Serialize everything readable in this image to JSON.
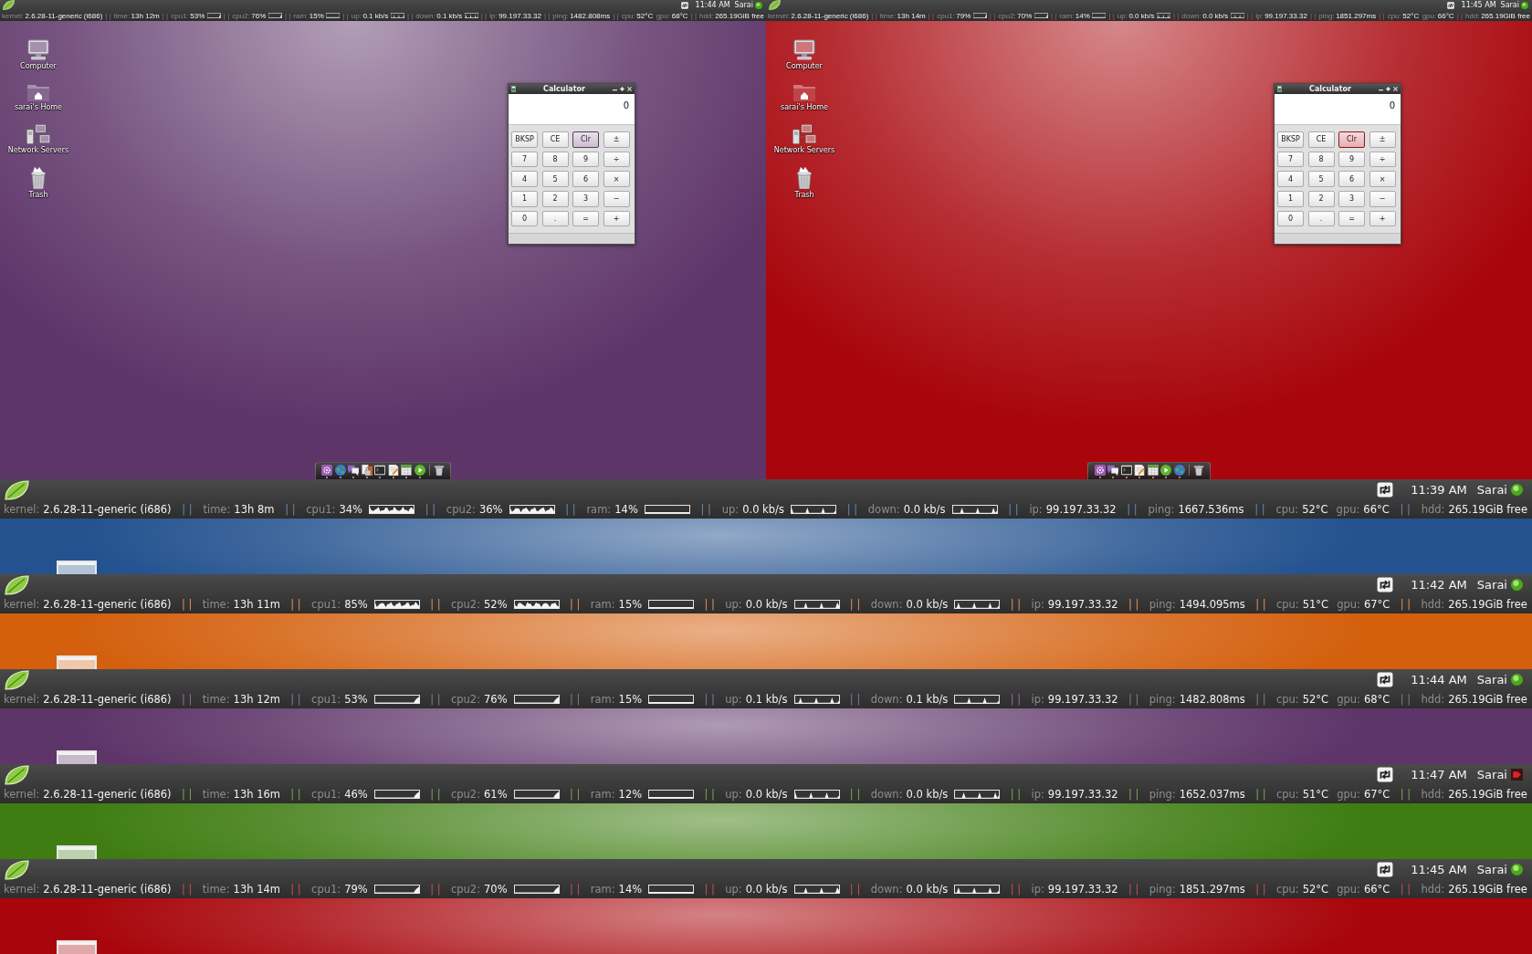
{
  "desktops": [
    {
      "color": "#5e3569",
      "panel": {
        "time": "11:44 AM",
        "user": "Sarai",
        "alert": false,
        "stats": [
          {
            "kind": "text",
            "label": "kernel:",
            "value": "2.6.28-11-generic (i686)"
          },
          {
            "kind": "sep",
            "text": "| |"
          },
          {
            "kind": "text",
            "label": "time:",
            "value": "13h 12m"
          },
          {
            "kind": "sep",
            "text": "| |"
          },
          {
            "kind": "graph",
            "label": "cpu1:",
            "value": "53%"
          },
          {
            "kind": "sep",
            "text": "| |"
          },
          {
            "kind": "graph",
            "label": "cpu2:",
            "value": "76%"
          },
          {
            "kind": "sep",
            "text": "| |"
          },
          {
            "kind": "graph",
            "label": "ram:",
            "value": "15%"
          },
          {
            "kind": "sep",
            "text": "| |"
          },
          {
            "kind": "graph",
            "label": "up:",
            "value": "0.1 kb/s"
          },
          {
            "kind": "sep",
            "text": "| |"
          },
          {
            "kind": "graph",
            "label": "down:",
            "value": "0.1 kb/s"
          },
          {
            "kind": "sep",
            "text": "| |"
          },
          {
            "kind": "text",
            "label": "ip:",
            "value": "99.197.33.32"
          },
          {
            "kind": "sep",
            "text": "| |"
          },
          {
            "kind": "text",
            "label": "ping:",
            "value": "1482.808ms"
          },
          {
            "kind": "sep",
            "text": "| |"
          },
          {
            "kind": "text",
            "label": "cpu:",
            "value": "52°C"
          },
          {
            "kind": "text",
            "label": "gpu:",
            "value": "68°C"
          },
          {
            "kind": "sep",
            "text": "| |"
          },
          {
            "kind": "text",
            "label": "hdd:",
            "value": "265.19GiB free"
          }
        ]
      },
      "icons": [
        {
          "kind": "computer",
          "label": "Computer"
        },
        {
          "kind": "home",
          "label": "sarai's Home"
        },
        {
          "kind": "network",
          "label": "Network Servers"
        },
        {
          "kind": "trash",
          "label": "Trash"
        }
      ],
      "calculator": {
        "title": "Calculator",
        "display": "0",
        "keys": [
          [
            {
              "label": "BKSP",
              "focused": false
            },
            {
              "label": "CE",
              "focused": false
            },
            {
              "label": "Clr",
              "focused": true
            },
            {
              "label": "±",
              "focused": false
            }
          ],
          [
            {
              "label": "7",
              "focused": false
            },
            {
              "label": "8",
              "focused": false
            },
            {
              "label": "9",
              "focused": false
            },
            {
              "label": "÷",
              "focused": false
            }
          ],
          [
            {
              "label": "4",
              "focused": false
            },
            {
              "label": "5",
              "focused": false
            },
            {
              "label": "6",
              "focused": false
            },
            {
              "label": "×",
              "focused": false
            }
          ],
          [
            {
              "label": "1",
              "focused": false
            },
            {
              "label": "2",
              "focused": false
            },
            {
              "label": "3",
              "focused": false
            },
            {
              "label": "−",
              "focused": false
            }
          ],
          [
            {
              "label": "0",
              "focused": false
            },
            {
              "label": ".",
              "focused": false
            },
            {
              "label": "=",
              "focused": false
            },
            {
              "label": "+",
              "focused": false
            }
          ]
        ]
      },
      "dock": [
        {
          "kind": "settings",
          "running": true
        },
        {
          "kind": "globe",
          "running": true
        },
        {
          "kind": "chat",
          "running": true
        },
        {
          "kind": "padlock",
          "running": true
        },
        {
          "kind": "terminal",
          "running": true
        },
        {
          "kind": "editor",
          "running": true
        },
        {
          "kind": "spreadsheet",
          "running": true
        },
        {
          "kind": "play",
          "running": true
        },
        {
          "kind": "trash",
          "running": false
        }
      ]
    },
    {
      "color": "#a8060c",
      "panel": {
        "time": "11:45 AM",
        "user": "Sarai",
        "alert": false,
        "stats": [
          {
            "kind": "text",
            "label": "kernel:",
            "value": "2.6.28-11-generic (i686)"
          },
          {
            "kind": "sep",
            "text": "| |"
          },
          {
            "kind": "text",
            "label": "time:",
            "value": "13h 14m"
          },
          {
            "kind": "sep",
            "text": "| |"
          },
          {
            "kind": "graph",
            "label": "cpu1:",
            "value": "79%"
          },
          {
            "kind": "sep",
            "text": "| |"
          },
          {
            "kind": "graph",
            "label": "cpu2:",
            "value": "70%"
          },
          {
            "kind": "sep",
            "text": "| |"
          },
          {
            "kind": "graph",
            "label": "ram:",
            "value": "14%"
          },
          {
            "kind": "sep",
            "text": "| |"
          },
          {
            "kind": "graph",
            "label": "up:",
            "value": "0.0 kb/s"
          },
          {
            "kind": "sep",
            "text": "| |"
          },
          {
            "kind": "graph",
            "label": "down:",
            "value": "0.0 kb/s"
          },
          {
            "kind": "sep",
            "text": "| |"
          },
          {
            "kind": "text",
            "label": "ip:",
            "value": "99.197.33.32"
          },
          {
            "kind": "sep",
            "text": "| |"
          },
          {
            "kind": "text",
            "label": "ping:",
            "value": "1851.297ms"
          },
          {
            "kind": "sep",
            "text": "| |"
          },
          {
            "kind": "text",
            "label": "cpu:",
            "value": "52°C"
          },
          {
            "kind": "text",
            "label": "gpu:",
            "value": "66°C"
          },
          {
            "kind": "sep",
            "text": "| |"
          },
          {
            "kind": "text",
            "label": "hdd:",
            "value": "265.19GiB free"
          }
        ]
      },
      "icons": [
        {
          "kind": "computer",
          "label": "Computer"
        },
        {
          "kind": "home",
          "label": "sarai's Home"
        },
        {
          "kind": "network",
          "label": "Network Servers"
        },
        {
          "kind": "trash",
          "label": "Trash"
        }
      ],
      "calculator": {
        "title": "Calculator",
        "display": "0",
        "keys": [
          [
            {
              "label": "BKSP",
              "focused": false
            },
            {
              "label": "CE",
              "focused": false
            },
            {
              "label": "Clr",
              "focused": true
            },
            {
              "label": "±",
              "focused": false
            }
          ],
          [
            {
              "label": "7",
              "focused": false
            },
            {
              "label": "8",
              "focused": false
            },
            {
              "label": "9",
              "focused": false
            },
            {
              "label": "÷",
              "focused": false
            }
          ],
          [
            {
              "label": "4",
              "focused": false
            },
            {
              "label": "5",
              "focused": false
            },
            {
              "label": "6",
              "focused": false
            },
            {
              "label": "×",
              "focused": false
            }
          ],
          [
            {
              "label": "1",
              "focused": false
            },
            {
              "label": "2",
              "focused": false
            },
            {
              "label": "3",
              "focused": false
            },
            {
              "label": "−",
              "focused": false
            }
          ],
          [
            {
              "label": "0",
              "focused": false
            },
            {
              "label": ".",
              "focused": false
            },
            {
              "label": "=",
              "focused": false
            },
            {
              "label": "+",
              "focused": false
            }
          ]
        ]
      },
      "dock": [
        {
          "kind": "settings",
          "running": true
        },
        {
          "kind": "chat",
          "running": true
        },
        {
          "kind": "terminal",
          "running": true
        },
        {
          "kind": "editor",
          "running": true
        },
        {
          "kind": "spreadsheet",
          "running": true
        },
        {
          "kind": "play",
          "running": true
        },
        {
          "kind": "globe",
          "running": true
        },
        {
          "kind": "trash",
          "running": false
        }
      ]
    }
  ],
  "strips": [
    {
      "color": "#24528f",
      "panel": {
        "time": "11:39 AM",
        "user": "Sarai",
        "alert": false,
        "stats": [
          {
            "kind": "text",
            "label": "kernel:",
            "value": "2.6.28-11-generic (i686)"
          },
          {
            "kind": "sep",
            "text": "| |"
          },
          {
            "kind": "text",
            "label": "time:",
            "value": "13h 8m"
          },
          {
            "kind": "sep",
            "text": "| |"
          },
          {
            "kind": "graph",
            "label": "cpu1:",
            "value": "34%"
          },
          {
            "kind": "sep",
            "text": "| |"
          },
          {
            "kind": "graph",
            "label": "cpu2:",
            "value": "36%"
          },
          {
            "kind": "sep",
            "text": "| |"
          },
          {
            "kind": "graph",
            "label": "ram:",
            "value": "14%"
          },
          {
            "kind": "sep",
            "text": "| |"
          },
          {
            "kind": "graph",
            "label": "up:",
            "value": "0.0 kb/s"
          },
          {
            "kind": "sep",
            "text": "| |"
          },
          {
            "kind": "graph",
            "label": "down:",
            "value": "0.0 kb/s"
          },
          {
            "kind": "sep",
            "text": "| |"
          },
          {
            "kind": "text",
            "label": "ip:",
            "value": "99.197.33.32"
          },
          {
            "kind": "sep",
            "text": "| |"
          },
          {
            "kind": "text",
            "label": "ping:",
            "value": "1667.536ms"
          },
          {
            "kind": "sep",
            "text": "| |"
          },
          {
            "kind": "text",
            "label": "cpu:",
            "value": "52°C"
          },
          {
            "kind": "text",
            "label": "gpu:",
            "value": "66°C"
          },
          {
            "kind": "sep",
            "text": "| |"
          },
          {
            "kind": "text",
            "label": "hdd:",
            "value": "265.19GiB free"
          }
        ]
      }
    },
    {
      "color": "#d4600e",
      "panel": {
        "time": "11:42 AM",
        "user": "Sarai",
        "alert": false,
        "stats": [
          {
            "kind": "text",
            "label": "kernel:",
            "value": "2.6.28-11-generic (i686)"
          },
          {
            "kind": "sep",
            "text": "| |"
          },
          {
            "kind": "text",
            "label": "time:",
            "value": "13h 11m"
          },
          {
            "kind": "sep",
            "text": "| |"
          },
          {
            "kind": "graph",
            "label": "cpu1:",
            "value": "85%"
          },
          {
            "kind": "sep",
            "text": "| |"
          },
          {
            "kind": "graph",
            "label": "cpu2:",
            "value": "52%"
          },
          {
            "kind": "sep",
            "text": "| |"
          },
          {
            "kind": "graph",
            "label": "ram:",
            "value": "15%"
          },
          {
            "kind": "sep",
            "text": "| |"
          },
          {
            "kind": "graph",
            "label": "up:",
            "value": "0.0 kb/s"
          },
          {
            "kind": "sep",
            "text": "| |"
          },
          {
            "kind": "graph",
            "label": "down:",
            "value": "0.0 kb/s"
          },
          {
            "kind": "sep",
            "text": "| |"
          },
          {
            "kind": "text",
            "label": "ip:",
            "value": "99.197.33.32"
          },
          {
            "kind": "sep",
            "text": "| |"
          },
          {
            "kind": "text",
            "label": "ping:",
            "value": "1494.095ms"
          },
          {
            "kind": "sep",
            "text": "| |"
          },
          {
            "kind": "text",
            "label": "cpu:",
            "value": "51°C"
          },
          {
            "kind": "text",
            "label": "gpu:",
            "value": "67°C"
          },
          {
            "kind": "sep",
            "text": "| |"
          },
          {
            "kind": "text",
            "label": "hdd:",
            "value": "265.19GiB free"
          }
        ]
      }
    },
    {
      "color": "#5e3569",
      "panel": {
        "time": "11:44 AM",
        "user": "Sarai",
        "alert": false,
        "stats": [
          {
            "kind": "text",
            "label": "kernel:",
            "value": "2.6.28-11-generic (i686)"
          },
          {
            "kind": "sep",
            "text": "| |"
          },
          {
            "kind": "text",
            "label": "time:",
            "value": "13h 12m"
          },
          {
            "kind": "sep",
            "text": "| |"
          },
          {
            "kind": "graph",
            "label": "cpu1:",
            "value": "53%"
          },
          {
            "kind": "sep",
            "text": "| |"
          },
          {
            "kind": "graph",
            "label": "cpu2:",
            "value": "76%"
          },
          {
            "kind": "sep",
            "text": "| |"
          },
          {
            "kind": "graph",
            "label": "ram:",
            "value": "15%"
          },
          {
            "kind": "sep",
            "text": "| |"
          },
          {
            "kind": "graph",
            "label": "up:",
            "value": "0.1 kb/s"
          },
          {
            "kind": "sep",
            "text": "| |"
          },
          {
            "kind": "graph",
            "label": "down:",
            "value": "0.1 kb/s"
          },
          {
            "kind": "sep",
            "text": "| |"
          },
          {
            "kind": "text",
            "label": "ip:",
            "value": "99.197.33.32"
          },
          {
            "kind": "sep",
            "text": "| |"
          },
          {
            "kind": "text",
            "label": "ping:",
            "value": "1482.808ms"
          },
          {
            "kind": "sep",
            "text": "| |"
          },
          {
            "kind": "text",
            "label": "cpu:",
            "value": "52°C"
          },
          {
            "kind": "text",
            "label": "gpu:",
            "value": "68°C"
          },
          {
            "kind": "sep",
            "text": "| |"
          },
          {
            "kind": "text",
            "label": "hdd:",
            "value": "265.19GiB free"
          }
        ]
      }
    },
    {
      "color": "#3f7d12",
      "panel": {
        "time": "11:47 AM",
        "user": "Sarai",
        "alert": true,
        "stats": [
          {
            "kind": "text",
            "label": "kernel:",
            "value": "2.6.28-11-generic (i686)"
          },
          {
            "kind": "sep",
            "text": "| |"
          },
          {
            "kind": "text",
            "label": "time:",
            "value": "13h 16m"
          },
          {
            "kind": "sep",
            "text": "| |"
          },
          {
            "kind": "graph",
            "label": "cpu1:",
            "value": "46%"
          },
          {
            "kind": "sep",
            "text": "| |"
          },
          {
            "kind": "graph",
            "label": "cpu2:",
            "value": "61%"
          },
          {
            "kind": "sep",
            "text": "| |"
          },
          {
            "kind": "graph",
            "label": "ram:",
            "value": "12%"
          },
          {
            "kind": "sep",
            "text": "| |"
          },
          {
            "kind": "graph",
            "label": "up:",
            "value": "0.0 kb/s"
          },
          {
            "kind": "sep",
            "text": "| |"
          },
          {
            "kind": "graph",
            "label": "down:",
            "value": "0.0 kb/s"
          },
          {
            "kind": "sep",
            "text": "| |"
          },
          {
            "kind": "text",
            "label": "ip:",
            "value": "99.197.33.32"
          },
          {
            "kind": "sep",
            "text": "| |"
          },
          {
            "kind": "text",
            "label": "ping:",
            "value": "1652.037ms"
          },
          {
            "kind": "sep",
            "text": "| |"
          },
          {
            "kind": "text",
            "label": "cpu:",
            "value": "51°C"
          },
          {
            "kind": "text",
            "label": "gpu:",
            "value": "67°C"
          },
          {
            "kind": "sep",
            "text": "| |"
          },
          {
            "kind": "text",
            "label": "hdd:",
            "value": "265.19GiB free"
          }
        ]
      }
    },
    {
      "color": "#a8060c",
      "panel": {
        "time": "11:45 AM",
        "user": "Sarai",
        "alert": false,
        "stats": [
          {
            "kind": "text",
            "label": "kernel:",
            "value": "2.6.28-11-generic (i686)"
          },
          {
            "kind": "sep",
            "text": "| |"
          },
          {
            "kind": "text",
            "label": "time:",
            "value": "13h 14m"
          },
          {
            "kind": "sep",
            "text": "| |"
          },
          {
            "kind": "graph",
            "label": "cpu1:",
            "value": "79%"
          },
          {
            "kind": "sep",
            "text": "| |"
          },
          {
            "kind": "graph",
            "label": "cpu2:",
            "value": "70%"
          },
          {
            "kind": "sep",
            "text": "| |"
          },
          {
            "kind": "graph",
            "label": "ram:",
            "value": "14%"
          },
          {
            "kind": "sep",
            "text": "| |"
          },
          {
            "kind": "graph",
            "label": "up:",
            "value": "0.0 kb/s"
          },
          {
            "kind": "sep",
            "text": "| |"
          },
          {
            "kind": "graph",
            "label": "down:",
            "value": "0.0 kb/s"
          },
          {
            "kind": "sep",
            "text": "| |"
          },
          {
            "kind": "text",
            "label": "ip:",
            "value": "99.197.33.32"
          },
          {
            "kind": "sep",
            "text": "| |"
          },
          {
            "kind": "text",
            "label": "ping:",
            "value": "1851.297ms"
          },
          {
            "kind": "sep",
            "text": "| |"
          },
          {
            "kind": "text",
            "label": "cpu:",
            "value": "52°C"
          },
          {
            "kind": "text",
            "label": "gpu:",
            "value": "66°C"
          },
          {
            "kind": "sep",
            "text": "| |"
          },
          {
            "kind": "text",
            "label": "hdd:",
            "value": "265.19GiB free"
          }
        ]
      }
    }
  ]
}
